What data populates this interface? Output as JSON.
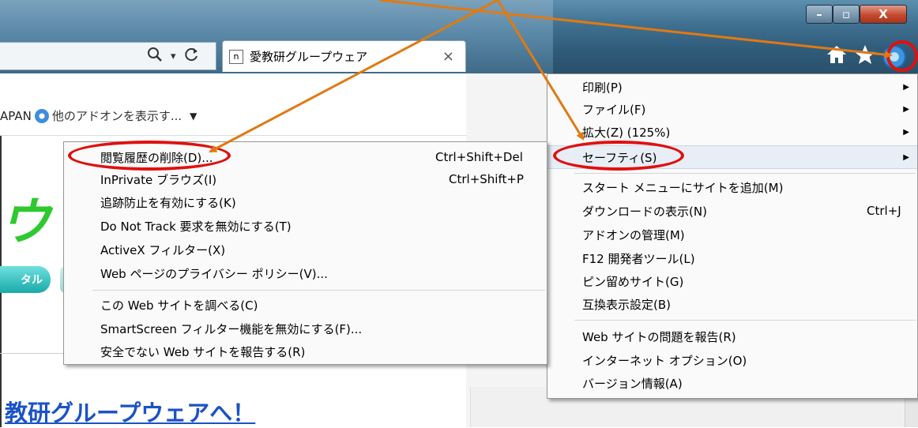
{
  "window": {
    "controls": {
      "minimize": "–",
      "maximize": "▫",
      "close": "X"
    }
  },
  "tab": {
    "favicon": "n",
    "title": "愛教研グループウェア",
    "close": "×"
  },
  "address_bar": {
    "search_icon": "search-icon",
    "dropdown": "▾",
    "refresh_icon": "refresh-icon"
  },
  "toolbar_icons": [
    "home-icon",
    "star-icon",
    "gear-icon"
  ],
  "favorites_bar": {
    "left_fragment": "APAN",
    "addons_label": "他のアドオンを表示す...",
    "dropdown": "▼"
  },
  "page": {
    "logo_fragment": "ウ",
    "portal_button": "タル",
    "welcome_link": "教研グループウェアへ！"
  },
  "main_menu": {
    "items": [
      {
        "label": "印刷(P)",
        "submenu": true
      },
      {
        "label": "ファイル(F)",
        "submenu": true
      },
      {
        "label": "拡大(Z) (125%)",
        "submenu": true
      },
      {
        "label": "セーフティ(S)",
        "submenu": true
      },
      {
        "label": "スタート メニューにサイトを追加(M)"
      },
      {
        "label": "ダウンロードの表示(N)",
        "shortcut": "Ctrl+J"
      },
      {
        "label": "アドオンの管理(M)"
      },
      {
        "label": "F12 開発者ツール(L)"
      },
      {
        "label": "ピン留めサイト(G)"
      },
      {
        "label": "互換表示設定(B)"
      },
      {
        "label": "Web サイトの問題を報告(R)"
      },
      {
        "label": "インターネット オプション(O)"
      },
      {
        "label": "バージョン情報(A)"
      }
    ]
  },
  "safety_submenu": {
    "items": [
      {
        "label": "閲覧履歴の削除(D)...",
        "shortcut": "Ctrl+Shift+Del"
      },
      {
        "label": "InPrivate ブラウズ(I)",
        "shortcut": "Ctrl+Shift+P"
      },
      {
        "label": "追跡防止を有効にする(K)"
      },
      {
        "label": "Do Not Track 要求を無効にする(T)"
      },
      {
        "label": "ActiveX フィルター(X)"
      },
      {
        "label": "Web ページのプライバシー ポリシー(V)..."
      },
      {
        "label": "この Web サイトを調べる(C)"
      },
      {
        "label": "SmartScreen フィルター機能を無効にする(F)..."
      },
      {
        "label": "安全でない Web サイトを報告する(R)"
      }
    ]
  },
  "colors": {
    "annotation_arrow": "#e07a12",
    "annotation_oval": "#e01010",
    "link": "#1b52c6"
  }
}
